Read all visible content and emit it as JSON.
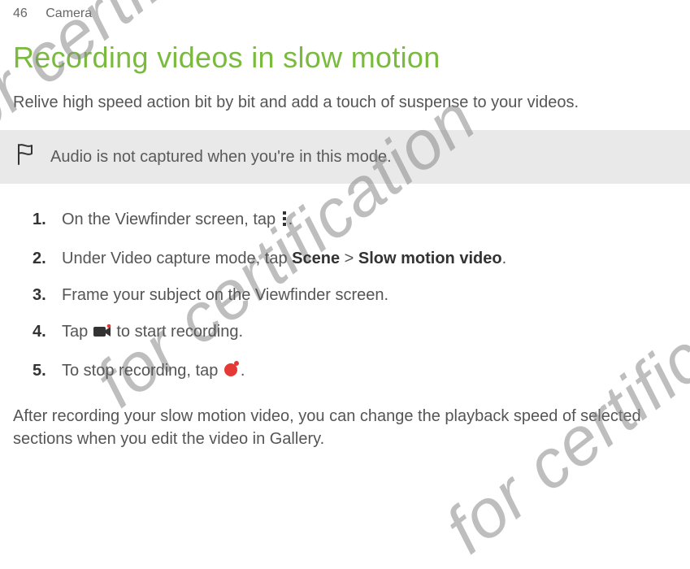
{
  "header": {
    "page_number": "46",
    "section": "Camera"
  },
  "heading": "Recording videos in slow motion",
  "intro": "Relive high speed action bit by bit and add a touch of suspense to your videos.",
  "note": "Audio is not captured when you're in this mode.",
  "steps": {
    "s1a": "On the Viewfinder screen, tap ",
    "s1b": ".",
    "s2a": "Under Video capture mode, tap ",
    "s2_bold1": "Scene",
    "s2_sep": " > ",
    "s2_bold2": "Slow motion video",
    "s2b": ".",
    "s3": "Frame your subject on the Viewfinder screen.",
    "s4a": "Tap ",
    "s4b": " to start recording.",
    "s5a": "To stop recording, tap ",
    "s5b": "."
  },
  "closing": "After recording your slow motion video, you can change the playback speed of selected sections when you edit the video in Gallery.",
  "watermark": "for certification"
}
